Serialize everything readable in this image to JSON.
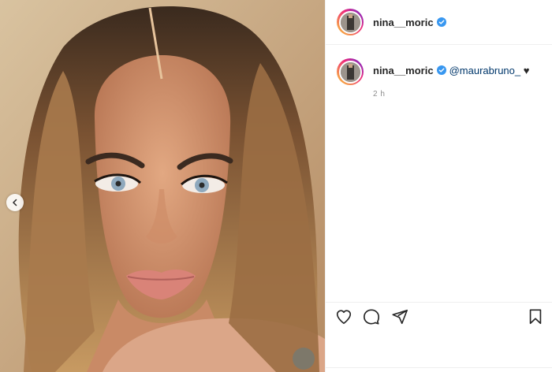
{
  "post": {
    "username": "nina__moric",
    "caption_mention": "@maurabruno_",
    "caption_suffix": " ♥",
    "timestamp": "2 h"
  },
  "icons": {
    "verified": "verified-badge-icon",
    "like": "heart-icon",
    "comment": "comment-icon",
    "share": "paper-plane-icon",
    "save": "bookmark-icon",
    "carousel_prev": "chevron-left-icon"
  },
  "colors": {
    "verified_blue": "#3897f0",
    "mention": "#00376b",
    "text": "#262626",
    "muted": "#8e8e8e"
  }
}
